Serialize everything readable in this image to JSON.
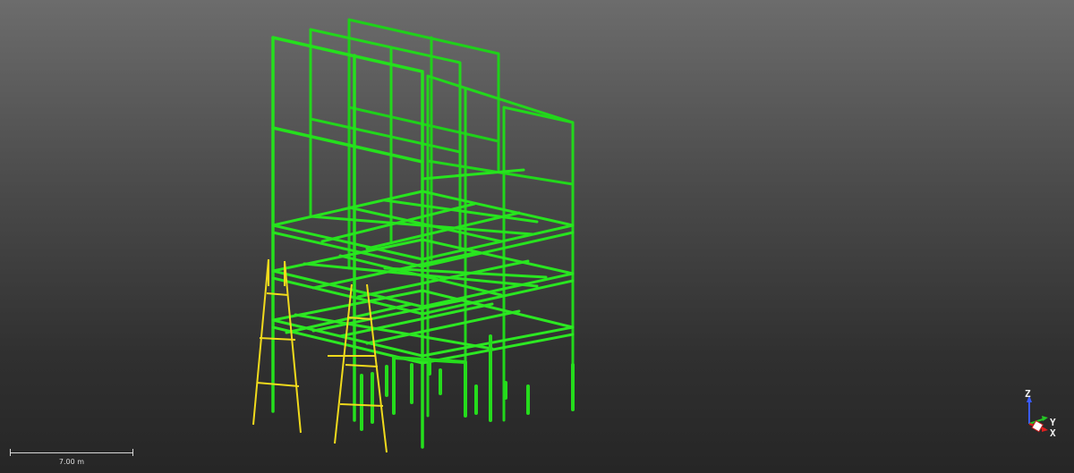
{
  "viewport": {
    "background_top": "#6c6c6c",
    "background_bottom": "#262626"
  },
  "scene": {
    "structure_color": "#22e01a",
    "ladder_color": "#f2dc1e",
    "description_objects": [
      "steel-frame-structure",
      "ladder-left",
      "ladder-right"
    ]
  },
  "scale_bar": {
    "label": "7.00 m"
  },
  "axis_gizmo": {
    "z_label": "Z",
    "y_label": "Y",
    "x_label": "X",
    "z_color": "#3a5bff",
    "y_color": "#25c625",
    "x_color": "#e02020"
  }
}
